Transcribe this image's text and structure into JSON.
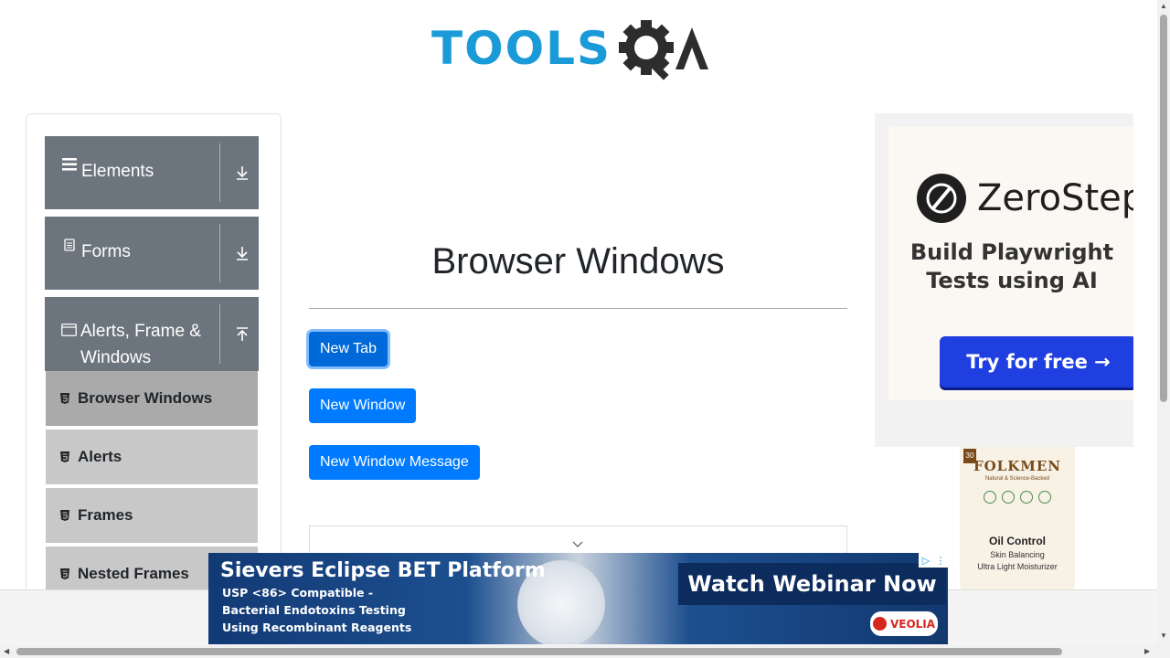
{
  "logo": {
    "text": "TOOLS",
    "suffix": "A"
  },
  "sidebar": {
    "groups": [
      {
        "label": "Elements",
        "icon": "hamburger-icon",
        "arrow": "download-arrow-icon"
      },
      {
        "label": "Forms",
        "icon": "document-icon",
        "arrow": "download-arrow-icon"
      },
      {
        "label": "Alerts, Frame & Windows",
        "icon": "window-icon",
        "arrow": "upload-arrow-icon"
      }
    ],
    "items": [
      {
        "label": "Browser Windows",
        "active": true
      },
      {
        "label": "Alerts",
        "active": false
      },
      {
        "label": "Frames",
        "active": false
      },
      {
        "label": "Nested Frames",
        "active": false
      }
    ]
  },
  "main": {
    "title": "Browser Windows",
    "buttons": {
      "new_tab": "New Tab",
      "new_window": "New Window",
      "new_window_message": "New Window Message"
    }
  },
  "ad_right": {
    "brand": "ZeroStep",
    "line1": "Build Playwright",
    "line2": "Tests using AI",
    "cta": "Try for free →"
  },
  "ad_product": {
    "brand": "FOLKMEN",
    "badge": "30",
    "tagline": "Natural & Science-Backed",
    "name": "Oil Control",
    "desc1": "Skin Balancing",
    "desc2": "Ultra Light Moisturizer"
  },
  "ad_bottom": {
    "headline": "Sievers Eclipse BET Platform",
    "line1": "USP <86> Compatible -",
    "line2": "Bacterial Endotoxins Testing",
    "line3": "Using Recombinant Reagents",
    "cta": "Watch Webinar Now",
    "sponsor": "VEOLIA"
  },
  "colors": {
    "brand_blue": "#1a9bd7",
    "primary_button": "#007bff",
    "sidebar_group": "#6c757d",
    "sidebar_item": "#c8c8c8",
    "sidebar_item_active": "#aaaaaa"
  }
}
